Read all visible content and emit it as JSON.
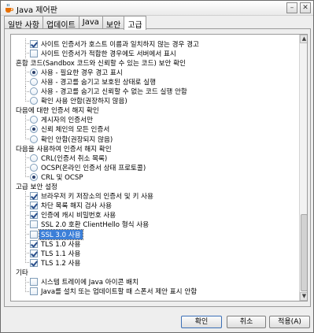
{
  "window": {
    "title": "Java 제어판",
    "minimize_label": "–",
    "close_label": "✕",
    "icon": "java-cup-icon"
  },
  "tabs": [
    "일반 사항",
    "업데이트",
    "Java",
    "보안",
    "고급"
  ],
  "active_tab": "고급",
  "rows": [
    {
      "kind": "checkbox",
      "indent": 1,
      "checked": true,
      "label": "사이트 인증서가 호스트 이름과 일치하지 않는 경우 경고"
    },
    {
      "kind": "checkbox",
      "indent": 1,
      "checked": false,
      "label": "사이트 인증서가 적합한 경우에도 서버에서 표시"
    },
    {
      "kind": "heading",
      "indent": 0,
      "label": "혼합 코드(Sandbox 코드와 신뢰할 수 있는 코드) 보안 확인"
    },
    {
      "kind": "radio",
      "indent": 1,
      "checked": true,
      "label": "사용 - 필요한 경우 경고 표시"
    },
    {
      "kind": "radio",
      "indent": 1,
      "checked": false,
      "label": "사용 - 경고를 숨기고 보호된 상태로 실행"
    },
    {
      "kind": "radio",
      "indent": 1,
      "checked": false,
      "label": "사용 - 경고를 숨기고 신뢰할 수 없는 코드 실행 안함"
    },
    {
      "kind": "radio",
      "indent": 1,
      "checked": false,
      "last": true,
      "label": "확인 사용 안함(권장하지 않음)"
    },
    {
      "kind": "heading",
      "indent": 0,
      "label": "다음에 대한 인증서 해지 확인"
    },
    {
      "kind": "radio",
      "indent": 1,
      "checked": false,
      "label": "게시자의 인증서만"
    },
    {
      "kind": "radio",
      "indent": 1,
      "checked": true,
      "label": "신뢰 체인의 모든 인증서"
    },
    {
      "kind": "radio",
      "indent": 1,
      "checked": false,
      "last": true,
      "label": "확인 안함(권장되지 않음)"
    },
    {
      "kind": "heading",
      "indent": 0,
      "label": "다음을 사용하여 인증서 해지 확인"
    },
    {
      "kind": "radio",
      "indent": 1,
      "checked": false,
      "label": "CRL(인증서 취소 목록)"
    },
    {
      "kind": "radio",
      "indent": 1,
      "checked": false,
      "label": "OCSP(온라인 인증서 상태 프로토콜)"
    },
    {
      "kind": "radio",
      "indent": 1,
      "checked": true,
      "last": true,
      "label": "CRL 및 OCSP"
    },
    {
      "kind": "heading",
      "indent": 0,
      "label": "고급 보안 설정"
    },
    {
      "kind": "checkbox",
      "indent": 1,
      "checked": true,
      "label": "브라우저 키 저장소의 인증서 및 키 사용"
    },
    {
      "kind": "checkbox",
      "indent": 1,
      "checked": true,
      "label": "차단 목록 해지 검사 사용"
    },
    {
      "kind": "checkbox",
      "indent": 1,
      "checked": true,
      "label": "인증에 캐시 비밀번호 사용"
    },
    {
      "kind": "checkbox",
      "indent": 1,
      "checked": false,
      "label": "SSL 2.0 호환 ClientHello 형식 사용"
    },
    {
      "kind": "checkbox",
      "indent": 1,
      "checked": false,
      "selected": true,
      "label": "SSL 3.0 사용"
    },
    {
      "kind": "checkbox",
      "indent": 1,
      "checked": true,
      "label": "TLS 1.0 사용"
    },
    {
      "kind": "checkbox",
      "indent": 1,
      "checked": true,
      "label": "TLS 1.1 사용"
    },
    {
      "kind": "checkbox",
      "indent": 1,
      "checked": true,
      "last": true,
      "label": "TLS 1.2 사용"
    },
    {
      "kind": "heading",
      "indent": 0,
      "label": "기타"
    },
    {
      "kind": "checkbox",
      "indent": 1,
      "checked": false,
      "label": "시스템 트레이에 Java 아이콘 배치"
    },
    {
      "kind": "checkbox",
      "indent": 1,
      "checked": false,
      "last": true,
      "label": "Java를 설치 또는 업데이트할 때 스폰서 제안 표시 안함"
    }
  ],
  "buttons": {
    "ok": "확인",
    "cancel": "취소",
    "apply": "적용(A)"
  },
  "scrollbar": {
    "up_icon": "▲",
    "down_icon": "▼"
  }
}
